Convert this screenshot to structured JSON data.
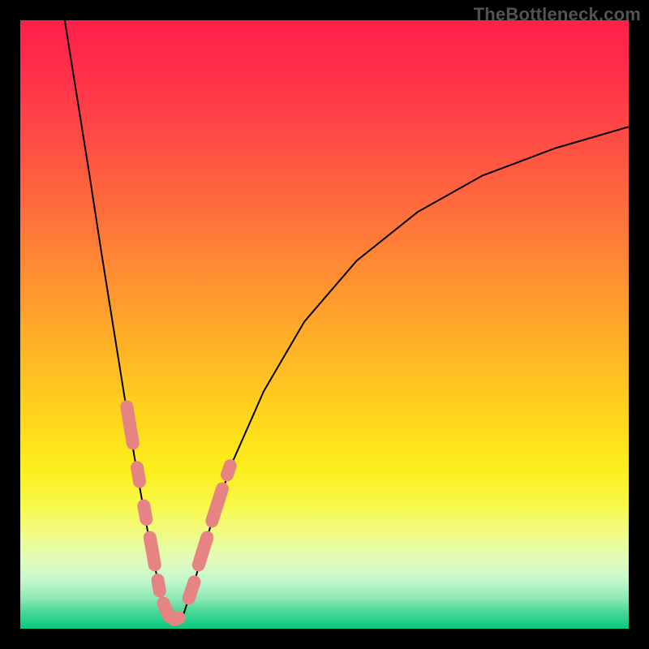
{
  "watermark": "TheBottleneck.com",
  "colors": {
    "background": "#000000",
    "curve_stroke": "#000000",
    "datapoint_stroke": "#e58482"
  },
  "chart_data": {
    "type": "line",
    "title": "",
    "xlabel": "",
    "ylabel": "",
    "xlim": [
      0,
      100
    ],
    "ylim": [
      0,
      100
    ],
    "grid": false,
    "legend": false,
    "note": "Axes are unlabeled; x/y values are normalized percentages read from pixel positions within the 750×750 plot area (x left→right, y bottom→top).",
    "series": [
      {
        "name": "left-curve",
        "x": [
          7.3,
          9.3,
          11.3,
          13.3,
          15.3,
          17.3,
          19.3,
          21.3,
          22.7,
          24.0
        ],
        "y": [
          100.0,
          87.5,
          75.0,
          62.0,
          49.5,
          37.0,
          25.0,
          14.0,
          7.5,
          2.0
        ]
      },
      {
        "name": "right-curve",
        "x": [
          26.7,
          28.7,
          31.3,
          34.7,
          40.0,
          46.7,
          55.3,
          65.3,
          76.0,
          88.0,
          100.0
        ],
        "y": [
          2.0,
          8.0,
          17.0,
          27.0,
          39.0,
          50.5,
          60.5,
          68.5,
          74.5,
          79.0,
          82.5
        ]
      }
    ],
    "datapoints_overlay": {
      "description": "Short pink capsule segments overlaid along both curves near the minimum.",
      "segments": [
        {
          "x1": 17.5,
          "y1": 36.5,
          "x2": 18.5,
          "y2": 30.5
        },
        {
          "x1": 19.2,
          "y1": 26.5,
          "x2": 19.6,
          "y2": 24.2
        },
        {
          "x1": 20.3,
          "y1": 20.2,
          "x2": 20.7,
          "y2": 18.0
        },
        {
          "x1": 21.3,
          "y1": 15.0,
          "x2": 22.1,
          "y2": 10.5
        },
        {
          "x1": 22.6,
          "y1": 8.0,
          "x2": 22.9,
          "y2": 6.2
        },
        {
          "x1": 23.5,
          "y1": 4.2,
          "x2": 24.5,
          "y2": 2.0
        },
        {
          "x1": 25.3,
          "y1": 1.5,
          "x2": 26.1,
          "y2": 1.8
        },
        {
          "x1": 27.7,
          "y1": 5.0,
          "x2": 28.6,
          "y2": 7.7
        },
        {
          "x1": 29.3,
          "y1": 10.5,
          "x2": 30.7,
          "y2": 15.0
        },
        {
          "x1": 31.5,
          "y1": 17.7,
          "x2": 33.2,
          "y2": 23.0
        },
        {
          "x1": 34.0,
          "y1": 25.3,
          "x2": 34.5,
          "y2": 26.8
        }
      ]
    }
  }
}
